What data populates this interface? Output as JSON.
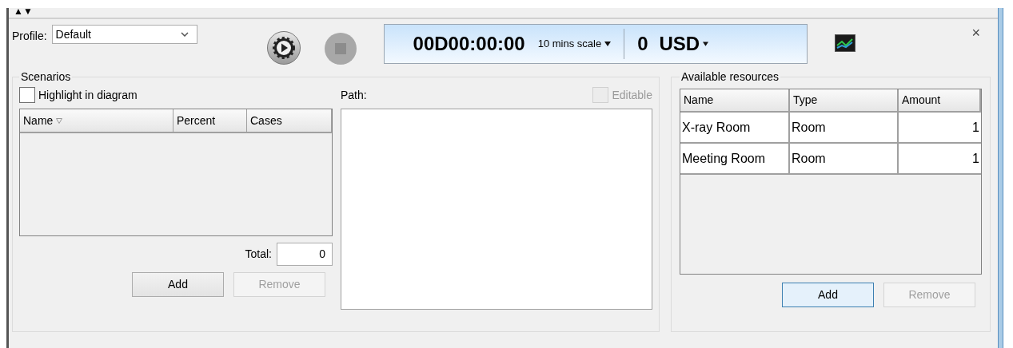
{
  "collapse_toggle": "▲▼",
  "close": "×",
  "profile": {
    "label": "Profile:",
    "value": "Default"
  },
  "timer": {
    "time": "00D00:00:00",
    "scale": "10 mins scale",
    "amount": "0",
    "currency": "USD"
  },
  "scenarios": {
    "title": "Scenarios",
    "highlight": {
      "label": "Highlight in diagram",
      "checked": false
    },
    "columns": [
      {
        "label": "Name",
        "sortable": true
      },
      {
        "label": "Percent",
        "sortable": false
      },
      {
        "label": "Cases",
        "sortable": false
      }
    ],
    "total_label": "Total:",
    "total_value": "0",
    "buttons": [
      {
        "label": "Add",
        "disabled": false
      },
      {
        "label": "Remove",
        "disabled": true
      }
    ],
    "path_label": "Path:",
    "editable": {
      "label": "Editable",
      "checked": false,
      "disabled": true
    }
  },
  "resources": {
    "title": "Available resources",
    "columns": [
      "Name",
      "Type",
      "Amount"
    ],
    "rows": [
      {
        "name": "X-ray Room",
        "type": "Room",
        "amount": "1"
      },
      {
        "name": "Meeting Room",
        "type": "Room",
        "amount": "1"
      }
    ],
    "buttons": [
      {
        "label": "Add",
        "disabled": false,
        "hovered": true
      },
      {
        "label": "Remove",
        "disabled": true,
        "hovered": false
      }
    ]
  }
}
